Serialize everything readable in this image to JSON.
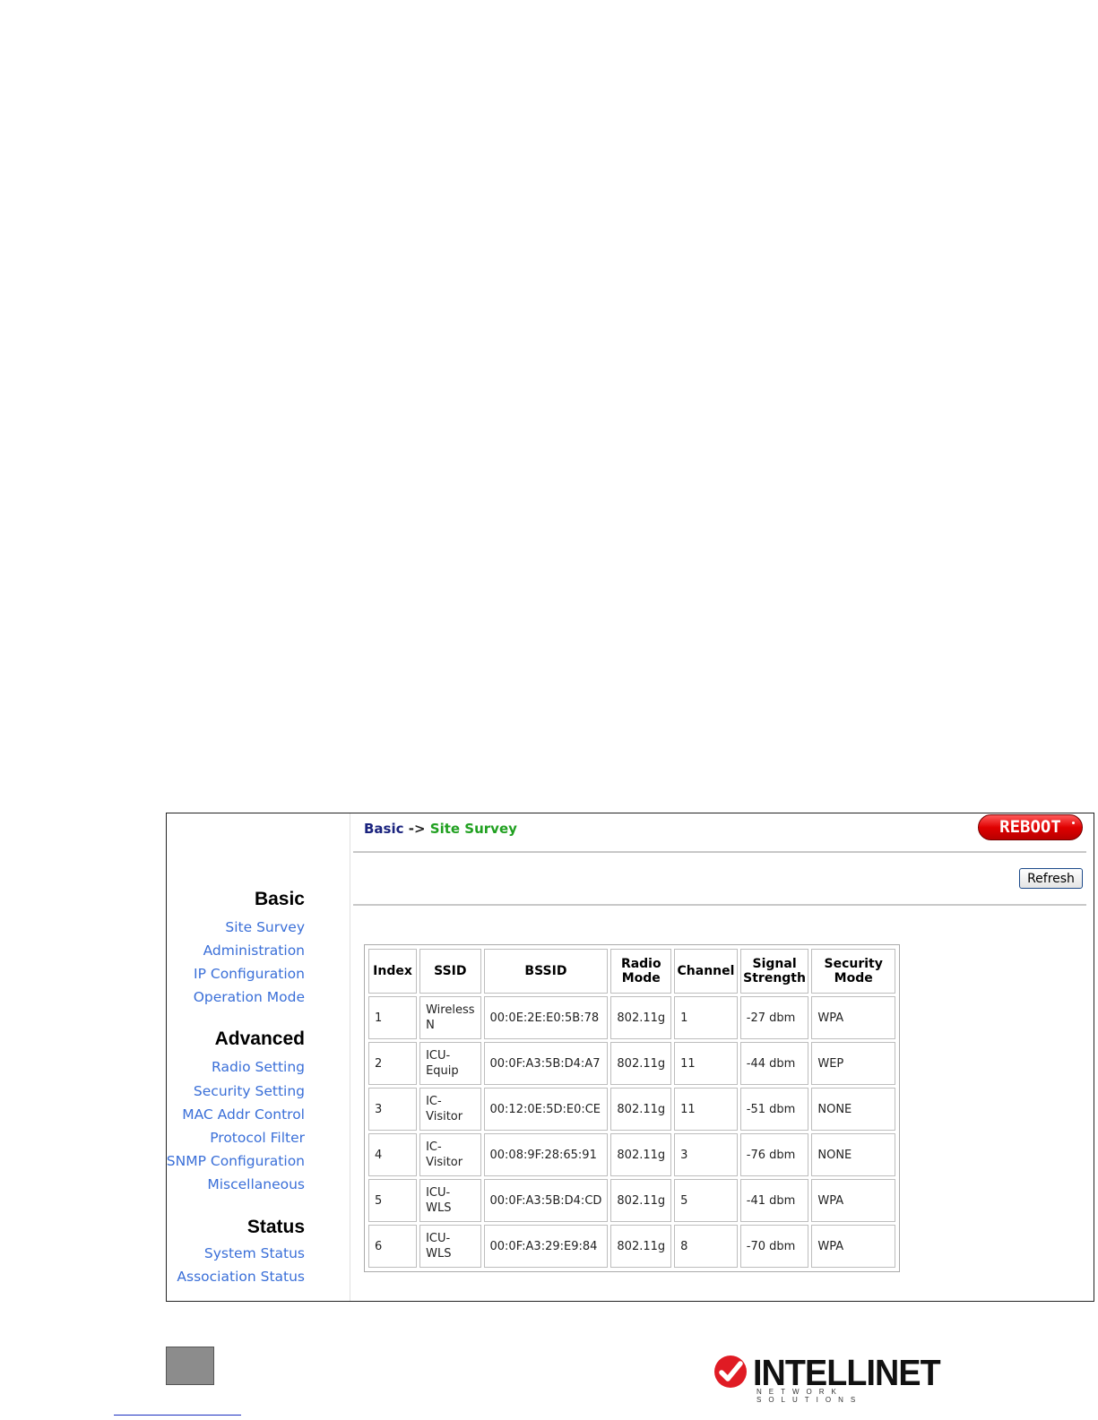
{
  "sidebar": {
    "sections": [
      {
        "title": "Basic",
        "items": [
          "Site Survey",
          "Administration",
          "IP Configuration",
          "Operation Mode"
        ]
      },
      {
        "title": "Advanced",
        "items": [
          "Radio Setting",
          "Security Setting",
          "MAC Addr Control",
          "Protocol Filter",
          "SNMP Configuration",
          "Miscellaneous"
        ]
      },
      {
        "title": "Status",
        "items": [
          "System Status",
          "Association Status"
        ]
      }
    ]
  },
  "breadcrumb": {
    "basic": "Basic",
    "arrow": "->",
    "current": "Site Survey"
  },
  "toolbar": {
    "reboot_label": "REBOOT",
    "refresh_label": "Refresh"
  },
  "table": {
    "headers": [
      "Index",
      "SSID",
      "BSSID",
      "Radio Mode",
      "Channel",
      "Signal Strength",
      "Security Mode"
    ],
    "rows": [
      [
        "1",
        "Wireless N",
        "00:0E:2E:E0:5B:78",
        "802.11g",
        "1",
        "-27 dbm",
        "WPA"
      ],
      [
        "2",
        "ICU-Equip",
        "00:0F:A3:5B:D4:A7",
        "802.11g",
        "11",
        "-44 dbm",
        "WEP"
      ],
      [
        "3",
        "IC-Visitor",
        "00:12:0E:5D:E0:CE",
        "802.11g",
        "11",
        "-51 dbm",
        "NONE"
      ],
      [
        "4",
        "IC-Visitor",
        "00:08:9F:28:65:91",
        "802.11g",
        "3",
        "-76 dbm",
        "NONE"
      ],
      [
        "5",
        "ICU-WLS",
        "00:0F:A3:5B:D4:CD",
        "802.11g",
        "5",
        "-41 dbm",
        "WPA"
      ],
      [
        "6",
        "ICU-WLS",
        "00:0F:A3:29:E9:84",
        "802.11g",
        "8",
        "-70 dbm",
        "WPA"
      ]
    ]
  },
  "footer": {
    "logo_word": "INTELLINET",
    "logo_sub": "NETWORK SOLUTIONS"
  },
  "colors": {
    "link": "#3a6fd8",
    "breadcrumb_current": "#20a020",
    "breadcrumb_basic": "#1a237e",
    "reboot": "#e00000"
  }
}
